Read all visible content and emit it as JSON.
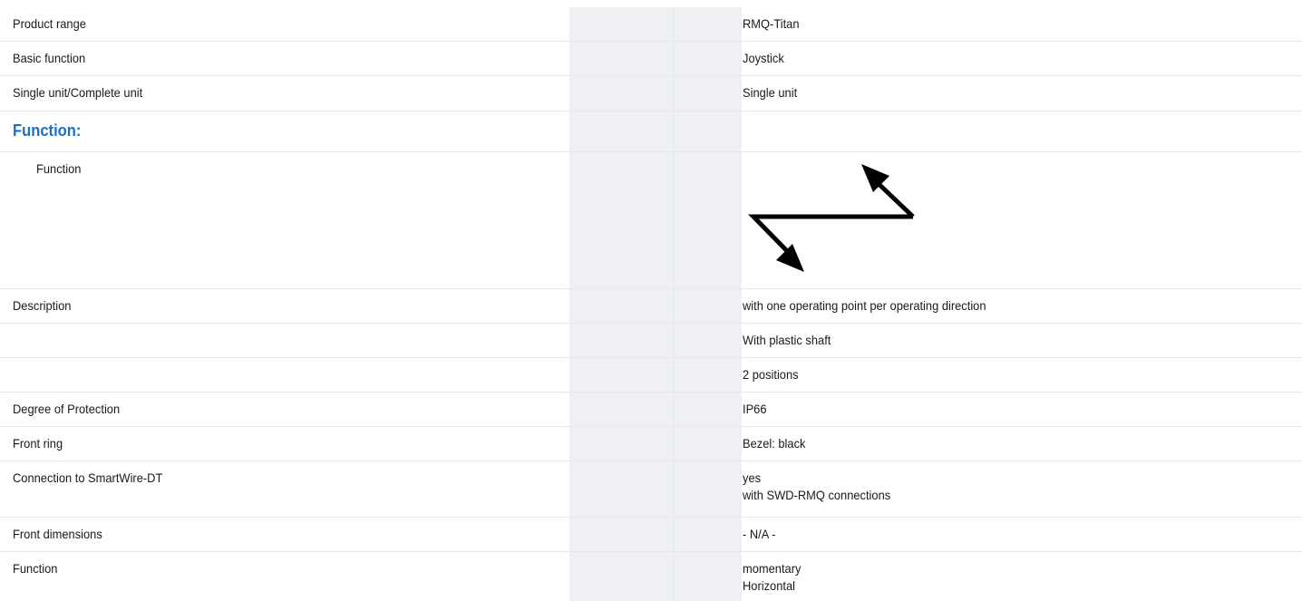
{
  "rows": [
    {
      "label": "Product range",
      "value": "RMQ-Titan"
    },
    {
      "label": "Basic function",
      "value": "Joystick"
    },
    {
      "label": "Single unit/Complete unit",
      "value": "Single unit"
    },
    {
      "section_title": "Function:"
    },
    {
      "label": "Function",
      "icon": "joystick-function-arrows-icon"
    },
    {
      "label": "Description",
      "value": "with one operating point per operating direction"
    },
    {
      "label": "",
      "value": "With plastic shaft"
    },
    {
      "label": "",
      "value": "2 positions"
    },
    {
      "label": "Degree of Protection",
      "value": "IP66"
    },
    {
      "label": "Front ring",
      "value": "Bezel: black"
    },
    {
      "label": "Connection to SmartWire-DT",
      "value_lines": [
        "yes",
        "with SWD-RMQ connections"
      ]
    },
    {
      "label": "Front dimensions",
      "value": "- N/A -"
    },
    {
      "label": "Function",
      "value_lines": [
        "momentary",
        "Horizontal"
      ]
    }
  ],
  "colors": {
    "section_title": "#1f6fc1",
    "band": "#eef0f3",
    "row_border": "#e6e8ec"
  }
}
